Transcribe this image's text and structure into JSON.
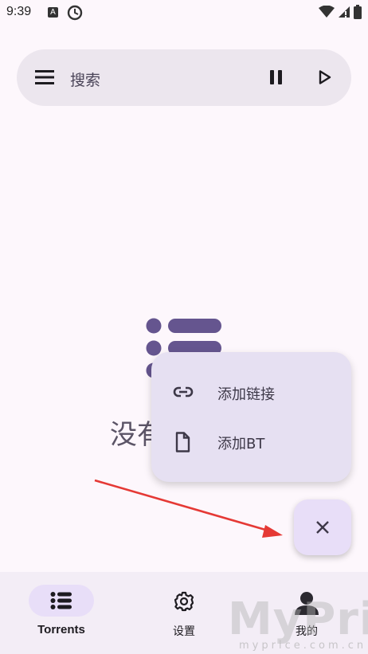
{
  "status_bar": {
    "time": "9:39",
    "left_icons": [
      "a-badge-icon",
      "clock-circle-icon"
    ],
    "right_icons": [
      "wifi-icon",
      "signal-icon",
      "battery-icon"
    ]
  },
  "search_bar": {
    "label": "搜索",
    "icons": [
      "menu-icon",
      "pause-icon",
      "play-icon"
    ]
  },
  "empty_state": {
    "icon": "list-icon",
    "text": "没有"
  },
  "popup_menu": {
    "items": [
      {
        "icon": "link-icon",
        "label": "添加链接"
      },
      {
        "icon": "file-icon",
        "label": "添加BT"
      }
    ]
  },
  "fab": {
    "icon": "close-icon"
  },
  "bottom_nav": {
    "items": [
      {
        "label": "Torrents",
        "icon": "list-icon",
        "selected": true
      },
      {
        "label": "设置",
        "icon": "gear-icon",
        "selected": false
      },
      {
        "label": "我的",
        "icon": "person-icon",
        "selected": false
      }
    ]
  },
  "watermark": {
    "text": "MyPrice",
    "url": "myprice.com.cn"
  },
  "colors": {
    "background": "#fdf7fc",
    "surface": "#ece6ee",
    "accent_container": "#e8def8",
    "primary": "#65558f",
    "annotation_arrow": "#e53935"
  }
}
